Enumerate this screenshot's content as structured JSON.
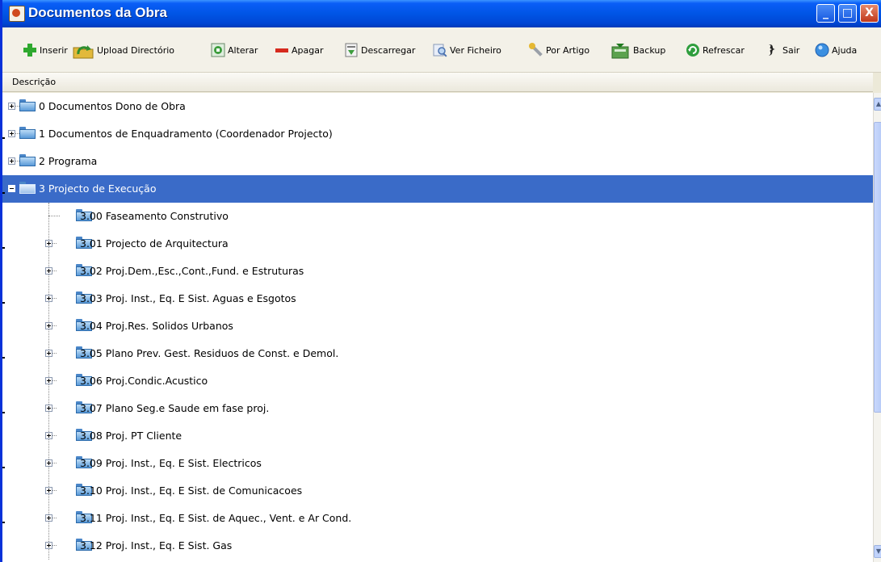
{
  "window": {
    "title": "Documentos da Obra",
    "controls": {
      "minimize": "_",
      "maximize": "□",
      "close": "X"
    }
  },
  "toolbar": {
    "buttons": [
      {
        "label": "Inserir",
        "icon": "plus-icon"
      },
      {
        "label": "Upload Directório",
        "icon": "upload-folder-icon"
      },
      {
        "label": "Alterar",
        "icon": "edit-icon"
      },
      {
        "label": "Apagar",
        "icon": "minus-icon"
      },
      {
        "label": "Descarregar",
        "icon": "download-icon"
      },
      {
        "label": "Ver Ficheiro",
        "icon": "view-file-icon"
      },
      {
        "label": "Por Artigo",
        "icon": "wrench-icon"
      },
      {
        "label": "Backup",
        "icon": "backup-icon"
      },
      {
        "label": "Refrescar",
        "icon": "refresh-icon"
      },
      {
        "label": "Sair",
        "icon": "exit-icon"
      },
      {
        "label": "Ajuda",
        "icon": "help-icon"
      }
    ]
  },
  "table": {
    "column_header": "Descrição"
  },
  "tree": {
    "items": [
      {
        "label": "0 Documentos Dono de Obra",
        "level": 0,
        "expander": "plus",
        "selected": false
      },
      {
        "label": "1 Documentos de Enquadramento (Coordenador Projecto)",
        "level": 0,
        "expander": "plus",
        "selected": false
      },
      {
        "label": "2 Programa",
        "level": 0,
        "expander": "plus",
        "selected": false
      },
      {
        "label": "3 Projecto de Execução",
        "level": 0,
        "expander": "minus",
        "selected": true
      },
      {
        "label": "3.00 Faseamento Construtivo",
        "level": 1,
        "expander": "none",
        "selected": false
      },
      {
        "label": "3.01 Projecto de Arquitectura",
        "level": 1,
        "expander": "plus",
        "selected": false
      },
      {
        "label": "3.02 Proj.Dem.,Esc.,Cont.,Fund. e Estruturas",
        "level": 1,
        "expander": "plus",
        "selected": false
      },
      {
        "label": "3.03 Proj. Inst., Eq. E Sist. Aguas e Esgotos",
        "level": 1,
        "expander": "plus",
        "selected": false
      },
      {
        "label": "3.04 Proj.Res. Solidos Urbanos",
        "level": 1,
        "expander": "plus",
        "selected": false
      },
      {
        "label": "3.05 Plano Prev. Gest. Residuos de  Const. e Demol.",
        "level": 1,
        "expander": "plus",
        "selected": false
      },
      {
        "label": "3.06 Proj.Condic.Acustico",
        "level": 1,
        "expander": "plus",
        "selected": false
      },
      {
        "label": "3.07 Plano Seg.e Saude em fase proj.",
        "level": 1,
        "expander": "plus",
        "selected": false
      },
      {
        "label": "3.08 Proj. PT Cliente",
        "level": 1,
        "expander": "plus",
        "selected": false
      },
      {
        "label": "3.09 Proj. Inst., Eq. E Sist. Electricos",
        "level": 1,
        "expander": "plus",
        "selected": false
      },
      {
        "label": "3.10 Proj. Inst., Eq. E Sist. de Comunicacoes",
        "level": 1,
        "expander": "plus",
        "selected": false
      },
      {
        "label": "3.11 Proj. Inst., Eq. E Sist. de Aquec., Vent. e Ar Cond.",
        "level": 1,
        "expander": "plus",
        "selected": false
      },
      {
        "label": "3.12 Proj. Inst., Eq. E Sist. Gas",
        "level": 1,
        "expander": "plus",
        "selected": false
      }
    ]
  },
  "colors": {
    "title_bar": "#0055e5",
    "selection": "#3a6bc8",
    "toolbar_bg": "#f3f1e8",
    "folder": "#5a9ad8"
  }
}
